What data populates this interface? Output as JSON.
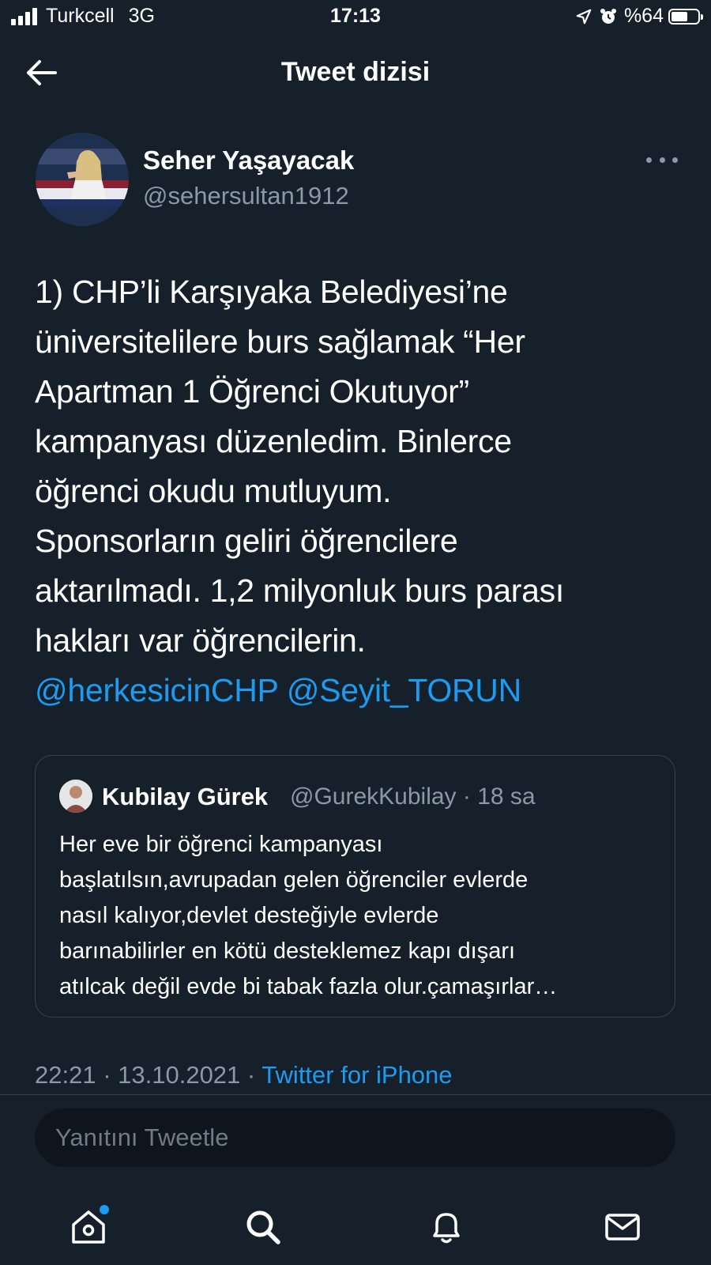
{
  "status_bar": {
    "carrier": "Turkcell",
    "network": "3G",
    "time": "17:13",
    "battery": "%64",
    "battery_level": 0.64
  },
  "header": {
    "title": "Tweet dizisi"
  },
  "tweet": {
    "author_name": "Seher Yaşayacak",
    "author_handle": "@sehersultan1912",
    "text_lines": [
      "1) CHP’li Karşıyaka Belediyesi’ne",
      "üniversitelilere burs sağlamak “Her",
      "Apartman 1 Öğrenci Okutuyor”",
      "kampanyası düzenledim. Binlerce",
      "öğrenci okudu mutluyum.",
      "Sponsorların geliri öğrencilere",
      "aktarılmadı. 1,2 milyonluk burs parası",
      "hakları var öğrencilerin."
    ],
    "mention_1": "@herkesicinCHP",
    "mention_2": "@Seyit_TORUN",
    "time": "22:21",
    "date": "13.10.2021",
    "source": "Twitter for iPhone"
  },
  "quoted_tweet": {
    "author_name": "Kubilay Gürek",
    "author_handle": "@GurekKubilay",
    "age": "18 sa",
    "text_lines": [
      "Her eve bir öğrenci kampanyası",
      "başlatılsın,avrupadan gelen öğrenciler evlerde",
      "nasıl kalıyor,devlet desteğiyle evlerde",
      "barınabilirler en kötü desteklemez kapı dışarı",
      "atılcak değil evde bi tabak fazla olur.çamaşırlar…"
    ]
  },
  "reply": {
    "placeholder": "Yanıtını Tweetle"
  },
  "colors": {
    "background": "#15202b",
    "accent": "#1d9bf0",
    "secondary_text": "#8b98a5"
  },
  "tab_bar": {
    "icons": [
      "home-icon",
      "search-icon",
      "notifications-icon",
      "messages-icon"
    ],
    "home_has_badge": true
  }
}
